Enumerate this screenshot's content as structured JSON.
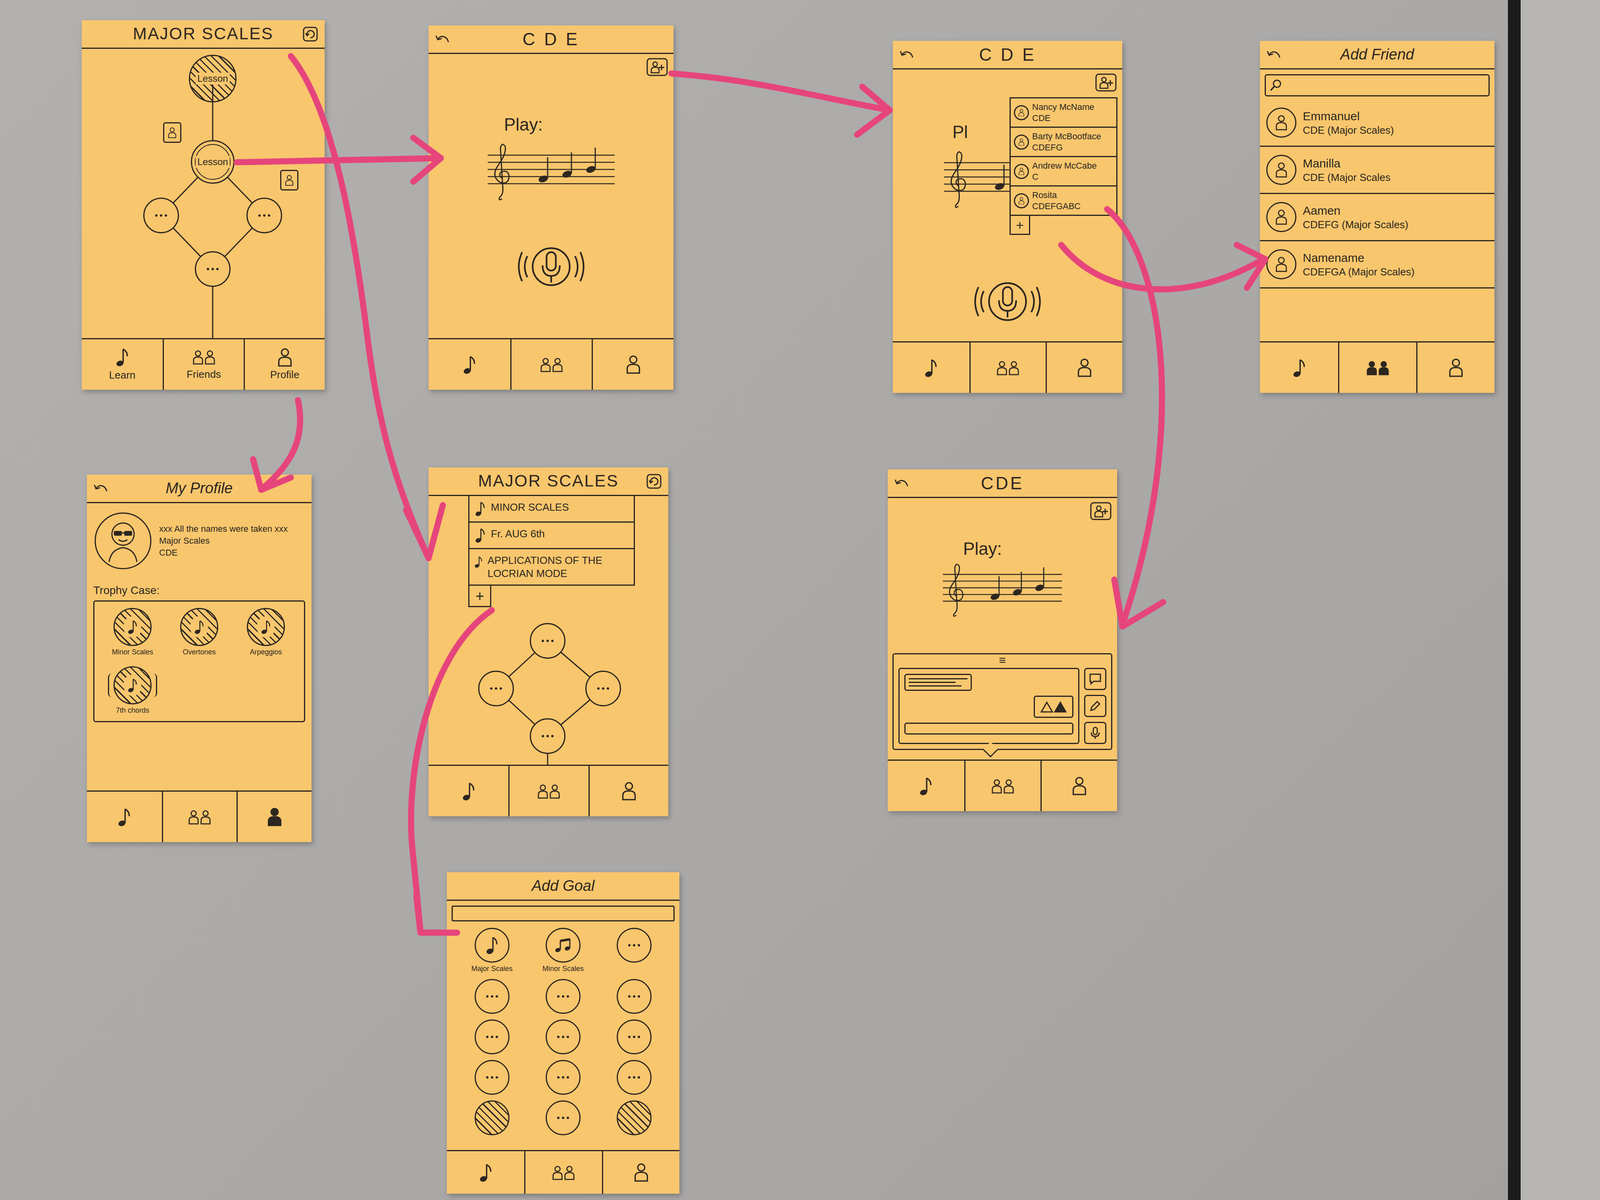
{
  "cards": [
    {
      "kind": "skill-tree",
      "title": "MAJOR SCALES",
      "back": false,
      "title_icon": true,
      "lessons": [
        {
          "label": "Lesson",
          "done": true
        },
        {
          "label": "Lesson",
          "done": false
        }
      ],
      "tabs": [
        {
          "label": "Learn",
          "selected": false
        },
        {
          "label": "Friends",
          "selected": false
        },
        {
          "label": "Profile",
          "selected": false
        }
      ]
    },
    {
      "kind": "lesson",
      "title": "C D E",
      "back": true,
      "title_icon": false,
      "prompt": "Play:",
      "tabs": [
        {
          "selected": false
        },
        {
          "selected": false
        },
        {
          "selected": false
        }
      ]
    },
    {
      "kind": "lesson-friends",
      "title": "C D E",
      "back": true,
      "title_icon": false,
      "prompt": "Pl",
      "friends": [
        {
          "name": "Nancy McName",
          "progress": "CDE"
        },
        {
          "name": "Barty McBootface",
          "progress": "CDEFG"
        },
        {
          "name": "Andrew McCabe",
          "progress": "C"
        },
        {
          "name": "Rosita",
          "progress": "CDEFGABC"
        }
      ],
      "add": "+",
      "tabs": [
        {
          "selected": false
        },
        {
          "selected": false
        },
        {
          "selected": false
        }
      ]
    },
    {
      "kind": "add-friend",
      "title": "Add Friend",
      "back": true,
      "title_icon": false,
      "people": [
        {
          "name": "Emmanuel",
          "progress": "CDE (Major Scales)"
        },
        {
          "name": "Manilla",
          "progress": "CDE (Major Scales"
        },
        {
          "name": "Aamen",
          "progress": "CDEFG (Major Scales)"
        },
        {
          "name": "Namename",
          "progress": "CDEFGA (Major Scales)"
        }
      ],
      "tabs": [
        {
          "selected": false
        },
        {
          "selected": true
        },
        {
          "selected": false
        }
      ]
    },
    {
      "kind": "profile",
      "title": "My Profile",
      "back": true,
      "title_icon": false,
      "user": {
        "name": "xxx All the names were taken xxx",
        "course": "Major Scales",
        "progress": "CDE"
      },
      "trophy_title": "Trophy Case:",
      "trophies": [
        {
          "label": "Minor Scales",
          "kind": "badge"
        },
        {
          "label": "Overtones",
          "kind": "badge"
        },
        {
          "label": "Arpeggios",
          "kind": "badge"
        },
        {
          "label": "7th chords",
          "kind": "sounding"
        }
      ],
      "tabs": [
        {
          "selected": false
        },
        {
          "selected": false
        },
        {
          "selected": true
        }
      ]
    },
    {
      "kind": "skill-tree-goals",
      "title": "MAJOR SCALES",
      "back": false,
      "title_icon": true,
      "goals": [
        "MINOR SCALES",
        "Fr. AUG 6th",
        "APPLICATIONS OF THE LOCRIAN MODE"
      ],
      "add": "+",
      "tabs": [
        {
          "selected": false
        },
        {
          "selected": false
        },
        {
          "selected": false
        }
      ]
    },
    {
      "kind": "lesson-chat",
      "title": "CDE",
      "back": true,
      "title_icon": false,
      "prompt": "Play:",
      "chat_handle": "≡",
      "tabs": [
        {
          "selected": false
        },
        {
          "selected": false
        },
        {
          "selected": false
        }
      ]
    },
    {
      "kind": "add-goal",
      "title": "Add Goal",
      "back": false,
      "title_icon": false,
      "goals": [
        {
          "label": "Major Scales",
          "kind": "single-note"
        },
        {
          "label": "Minor Scales",
          "kind": "double-note"
        },
        {
          "kind": "empty"
        },
        {
          "kind": "empty"
        },
        {
          "kind": "empty"
        },
        {
          "kind": "empty"
        },
        {
          "kind": "empty"
        },
        {
          "kind": "empty"
        },
        {
          "kind": "empty"
        },
        {
          "kind": "empty"
        },
        {
          "kind": "empty"
        },
        {
          "kind": "empty"
        },
        {
          "kind": "done"
        },
        {
          "kind": "empty"
        },
        {
          "kind": "done"
        }
      ],
      "tabs": [
        {
          "selected": false
        },
        {
          "selected": false
        },
        {
          "selected": false
        }
      ]
    }
  ],
  "arrows": [
    {
      "from": "skill-tree",
      "to": "lesson"
    },
    {
      "from": "skill-tree",
      "to": "skill-tree-goals"
    },
    {
      "from": "skill-tree",
      "to": "profile"
    },
    {
      "from": "lesson",
      "to": "lesson-friends"
    },
    {
      "from": "lesson-friends",
      "to": "add-friend"
    },
    {
      "from": "lesson-friends",
      "to": "lesson-chat"
    },
    {
      "from": "skill-tree-goals",
      "to": "add-goal"
    }
  ]
}
